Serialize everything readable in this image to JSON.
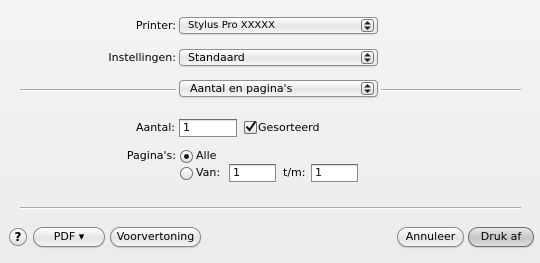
{
  "printer": {
    "label": "Printer:",
    "value": "Stylus Pro  XXXXX"
  },
  "settings": {
    "label": "Instellingen:",
    "value": "Standaard"
  },
  "section": {
    "value": "Aantal en pagina's"
  },
  "copies": {
    "label": "Aantal:",
    "value": "1",
    "collated_label": "Gesorteerd",
    "collated": true
  },
  "pages": {
    "label": "Pagina's:",
    "all_label": "Alle",
    "range_label": "Van:",
    "from": "1",
    "to_label": "t/m:",
    "to": "1",
    "selected": "all"
  },
  "footer": {
    "help": "?",
    "pdf": "PDF ▾",
    "preview": "Voorvertoning",
    "cancel": "Annuleer",
    "print": "Druk af"
  }
}
